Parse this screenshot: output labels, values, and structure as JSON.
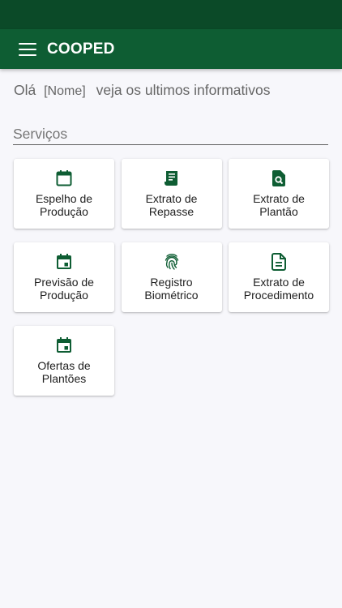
{
  "app": {
    "title": "COOPED",
    "accent_color": "#0e5d33",
    "status_bar_color": "#0b4a28"
  },
  "header": {
    "menu_icon": "menu-icon"
  },
  "greeting": {
    "hello": "Olá",
    "name": "[Nome]",
    "suffix": "veja os ultimos informativos"
  },
  "services": {
    "title": "Serviços",
    "items": [
      {
        "label": "Espelho de Produção",
        "icon": "calendar-outline-icon"
      },
      {
        "label": "Extrato de Repasse",
        "icon": "receipt-icon"
      },
      {
        "label": "Extrato de Plantão",
        "icon": "file-search-icon"
      },
      {
        "label": "Previsão de Produção",
        "icon": "calendar-event-icon"
      },
      {
        "label": "Registro Biométrico",
        "icon": "fingerprint-icon"
      },
      {
        "label": "Extrato de Procedimento",
        "icon": "document-icon"
      },
      {
        "label": "Ofertas de Plantões",
        "icon": "calendar-event-icon"
      }
    ]
  }
}
